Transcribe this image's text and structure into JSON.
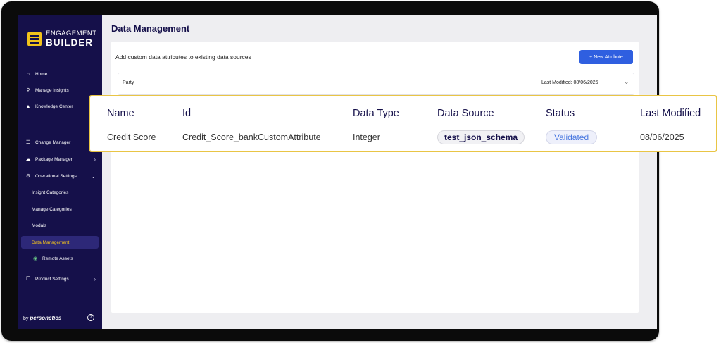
{
  "sidebar": {
    "logo_top": "ENGAGEMENT",
    "logo_bottom": "BUILDER",
    "items": [
      {
        "label": "Home"
      },
      {
        "label": "Manage Insights"
      },
      {
        "label": "Knowledge Center"
      },
      {
        "label": "Change Manager"
      },
      {
        "label": "Package Manager"
      },
      {
        "label": "Operational Settings"
      },
      {
        "label": "Insight Categories"
      },
      {
        "label": "Manage Categories"
      },
      {
        "label": "Modals"
      },
      {
        "label": "Data Management"
      },
      {
        "label": "Remote Assets"
      },
      {
        "label": "Product Settings"
      }
    ],
    "footer_by": "by",
    "footer_brand": "personetics"
  },
  "main": {
    "title": "Data Management",
    "description": "Add custom data attributes to existing data sources",
    "new_button": "+ New Attribute",
    "party_label": "Party",
    "party_modified": "Last Modified: 08/06/2025"
  },
  "table": {
    "headers": [
      "Name",
      "Id",
      "Data Type",
      "Data Source",
      "Status",
      "Last Modified"
    ],
    "row": {
      "name": "Credit Score",
      "id": "Credit_Score_bankCustomAttribute",
      "data_type": "Integer",
      "data_source": "test_json_schema",
      "status": "Validated",
      "last_modified": "08/06/2025"
    }
  },
  "icons": [
    "home-icon",
    "pin-icon",
    "graduation-cap-icon",
    "list-icon",
    "package-icon",
    "gear-icon",
    "status-dot-icon",
    "product-icon",
    "chevron-right-icon",
    "chevron-down-icon",
    "help-icon"
  ],
  "colors": {
    "sidebar": "#15104a",
    "accent": "#f2c31b",
    "primary_button": "#2f5fe0",
    "highlight_border": "#e9c545",
    "status_text": "#4a78e0"
  }
}
